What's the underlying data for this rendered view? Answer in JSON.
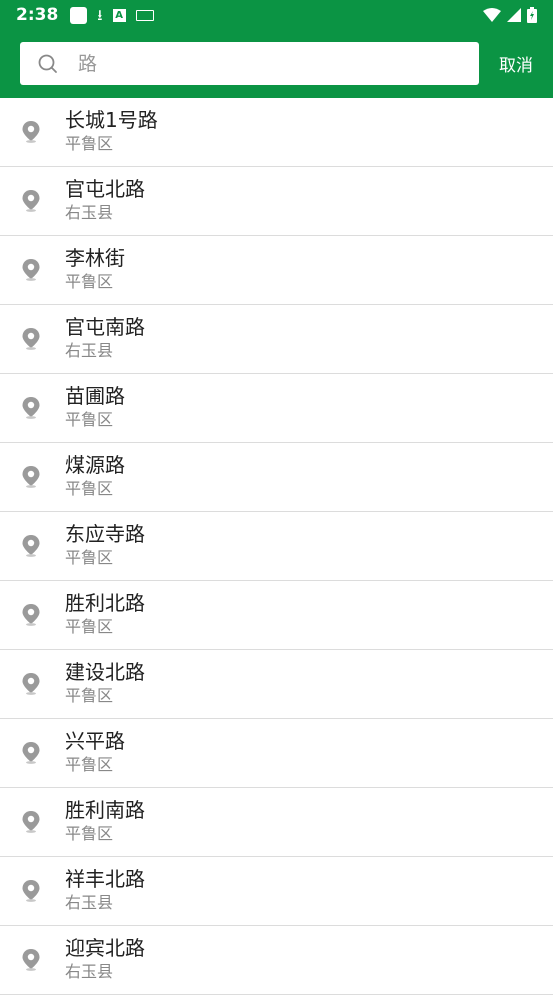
{
  "status_bar": {
    "time": "2:38"
  },
  "search": {
    "value": "",
    "placeholder": "路",
    "cancel_label": "取消"
  },
  "results": [
    {
      "name": "长城1号路",
      "district": "平鲁区"
    },
    {
      "name": "官屯北路",
      "district": "右玉县"
    },
    {
      "name": "李林街",
      "district": "平鲁区"
    },
    {
      "name": "官屯南路",
      "district": "右玉县"
    },
    {
      "name": "苗圃路",
      "district": "平鲁区"
    },
    {
      "name": "煤源路",
      "district": "平鲁区"
    },
    {
      "name": "东应寺路",
      "district": "平鲁区"
    },
    {
      "name": "胜利北路",
      "district": "平鲁区"
    },
    {
      "name": "建设北路",
      "district": "平鲁区"
    },
    {
      "name": "兴平路",
      "district": "平鲁区"
    },
    {
      "name": "胜利南路",
      "district": "平鲁区"
    },
    {
      "name": "祥丰北路",
      "district": "右玉县"
    },
    {
      "name": "迎宾北路",
      "district": "右玉县"
    }
  ],
  "colors": {
    "header": "#0b9444",
    "icon": "#9a9a9a"
  },
  "icons": {
    "result": "location-pin-icon",
    "search": "search-icon"
  }
}
